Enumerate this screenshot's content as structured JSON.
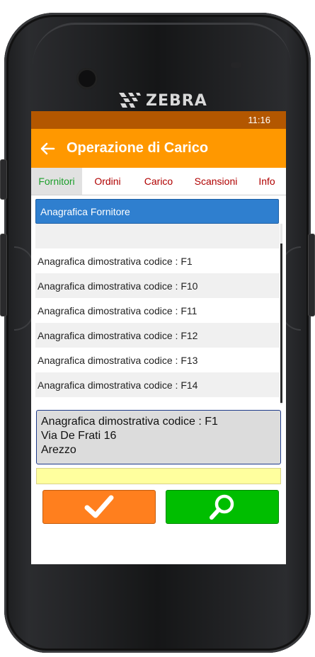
{
  "device": {
    "brand": "ZEBRA"
  },
  "statusbar": {
    "time": "11:16",
    "color": "#b35700"
  },
  "appbar": {
    "title": "Operazione di Carico",
    "back_icon": "arrow-left-icon",
    "color": "#ff9800"
  },
  "tabs": [
    {
      "label": "Fornitori",
      "active": true
    },
    {
      "label": "Ordini",
      "active": false
    },
    {
      "label": "Carico",
      "active": false
    },
    {
      "label": "Scansioni",
      "active": false
    },
    {
      "label": "Info",
      "active": false
    }
  ],
  "list": {
    "header": "Anagrafica Fornitore",
    "header_color": "#2f7fcf",
    "rows": [
      "",
      "Anagrafica dimostrativa codice : F1",
      "Anagrafica dimostrativa codice : F10",
      "Anagrafica dimostrativa codice : F11",
      "Anagrafica dimostrativa codice : F12",
      "Anagrafica dimostrativa codice : F13",
      "Anagrafica dimostrativa codice : F14",
      ""
    ]
  },
  "detail": {
    "name": "Anagrafica dimostrativa codice : F1",
    "address": "Via De Frati 16",
    "city": "Arezzo"
  },
  "notice": {
    "text": ""
  },
  "actions": {
    "confirm_icon": "checkmark-icon",
    "confirm_color": "#ff7f1e",
    "search_icon": "search-icon",
    "search_color": "#00be00"
  }
}
